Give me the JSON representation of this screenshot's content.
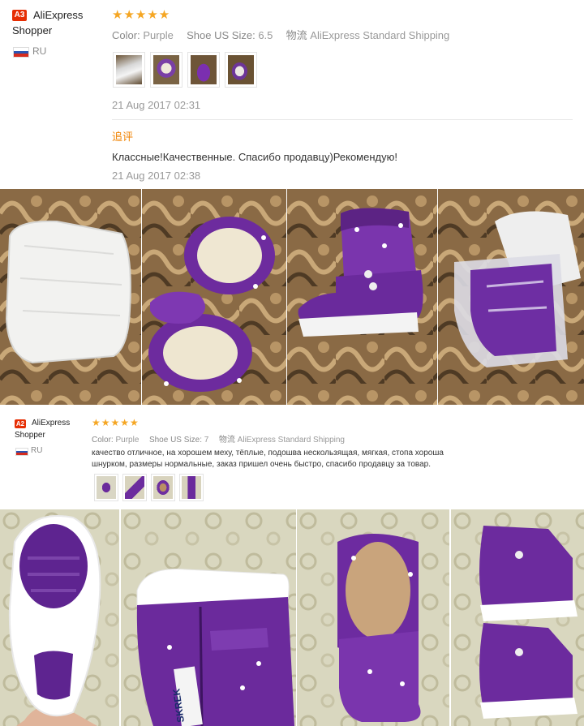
{
  "review1": {
    "badge": "A3",
    "user_line1": "AliExpress",
    "user_line2": "Shopper",
    "country": "RU",
    "stars": "★★★★★",
    "color_label": "Color:",
    "color_value": "Purple",
    "size_label": "Shoe US Size:",
    "size_value": "6.5",
    "shipping_label": "物流",
    "shipping_value": "AliExpress Standard Shipping",
    "date": "21 Aug 2017 02:31",
    "followup_label": "追评",
    "followup_text": "Классные!Качественные. Спасибо продавцу)Рекомендую!",
    "followup_date": "21 Aug 2017 02:38"
  },
  "review2": {
    "badge": "A2",
    "user_line1": "AliExpress",
    "user_line2": "Shopper",
    "country": "RU",
    "stars": "★★★★★",
    "color_label": "Color:",
    "color_value": "Purple",
    "size_label": "Shoe US Size:",
    "size_value": "7",
    "shipping_label": "物流",
    "shipping_value": "AliExpress Standard Shipping",
    "text_line1": "качество отличное, на хорошем меху, тёплые, подошва нескользящая, мягкая, стопа хороша",
    "text_line2": "шнурком, размеры нормальные, заказ пришел очень быстро, спасибо продавцу за товар."
  },
  "product_label": "SKREK",
  "colors": {
    "star": "#f5a623",
    "badge": "#e62e04",
    "followup": "#f08200",
    "boot_purple": "#6b2a9a"
  }
}
